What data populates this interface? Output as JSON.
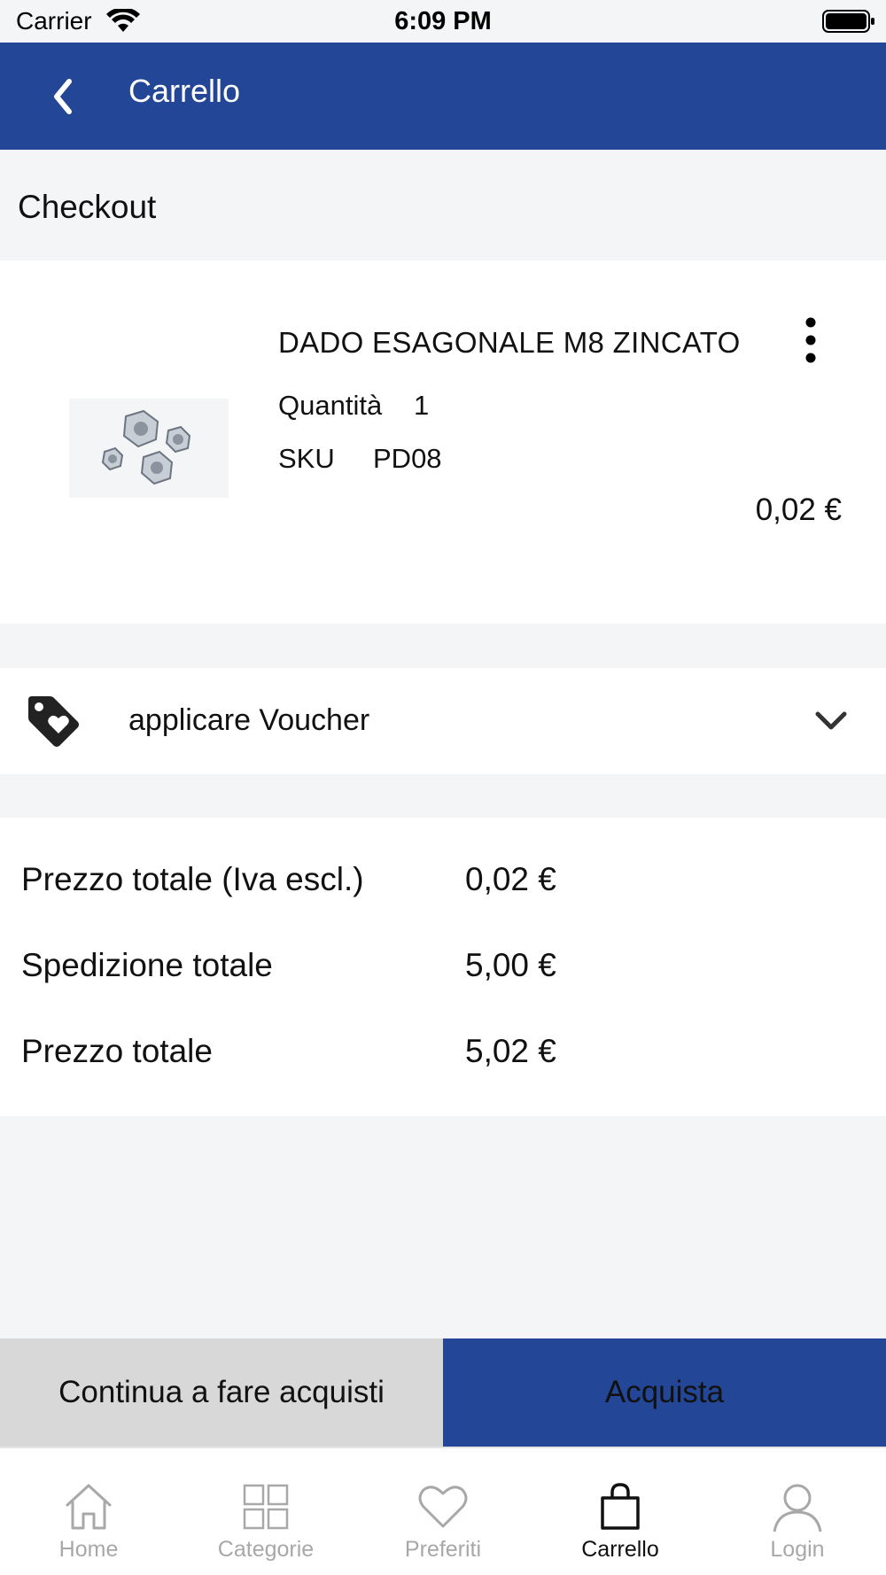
{
  "status_bar": {
    "carrier": "Carrier",
    "time": "6:09 PM"
  },
  "nav": {
    "title": "Carrello"
  },
  "checkout": {
    "title": "Checkout"
  },
  "product": {
    "name": "DADO ESAGONALE M8 ZINCATO",
    "quantity_label": "Quantità",
    "quantity_value": "1",
    "sku_label": "SKU",
    "sku_value": "PD08",
    "price": "0,02 €"
  },
  "voucher": {
    "label": "applicare Voucher"
  },
  "totals": [
    {
      "label": "Prezzo totale (Iva escl.)",
      "value": "0,02 €"
    },
    {
      "label": "Spedizione totale",
      "value": "5,00 €"
    },
    {
      "label": "Prezzo totale",
      "value": "5,02 €"
    }
  ],
  "actions": {
    "continue_label": "Continua a fare acquisti",
    "buy_label": "Acquista"
  },
  "tabs": [
    {
      "label": "Home",
      "icon": "home-icon",
      "active": false
    },
    {
      "label": "Categorie",
      "icon": "grid-icon",
      "active": false
    },
    {
      "label": "Preferiti",
      "icon": "heart-icon",
      "active": false
    },
    {
      "label": "Carrello",
      "icon": "shopping-bag-icon",
      "active": true
    },
    {
      "label": "Login",
      "icon": "user-icon",
      "active": false
    }
  ],
  "colors": {
    "primary": "#234696",
    "background": "#f3f5f6",
    "inactive_tab": "#a8a8a8",
    "secondary_button": "#d8d8d8"
  }
}
